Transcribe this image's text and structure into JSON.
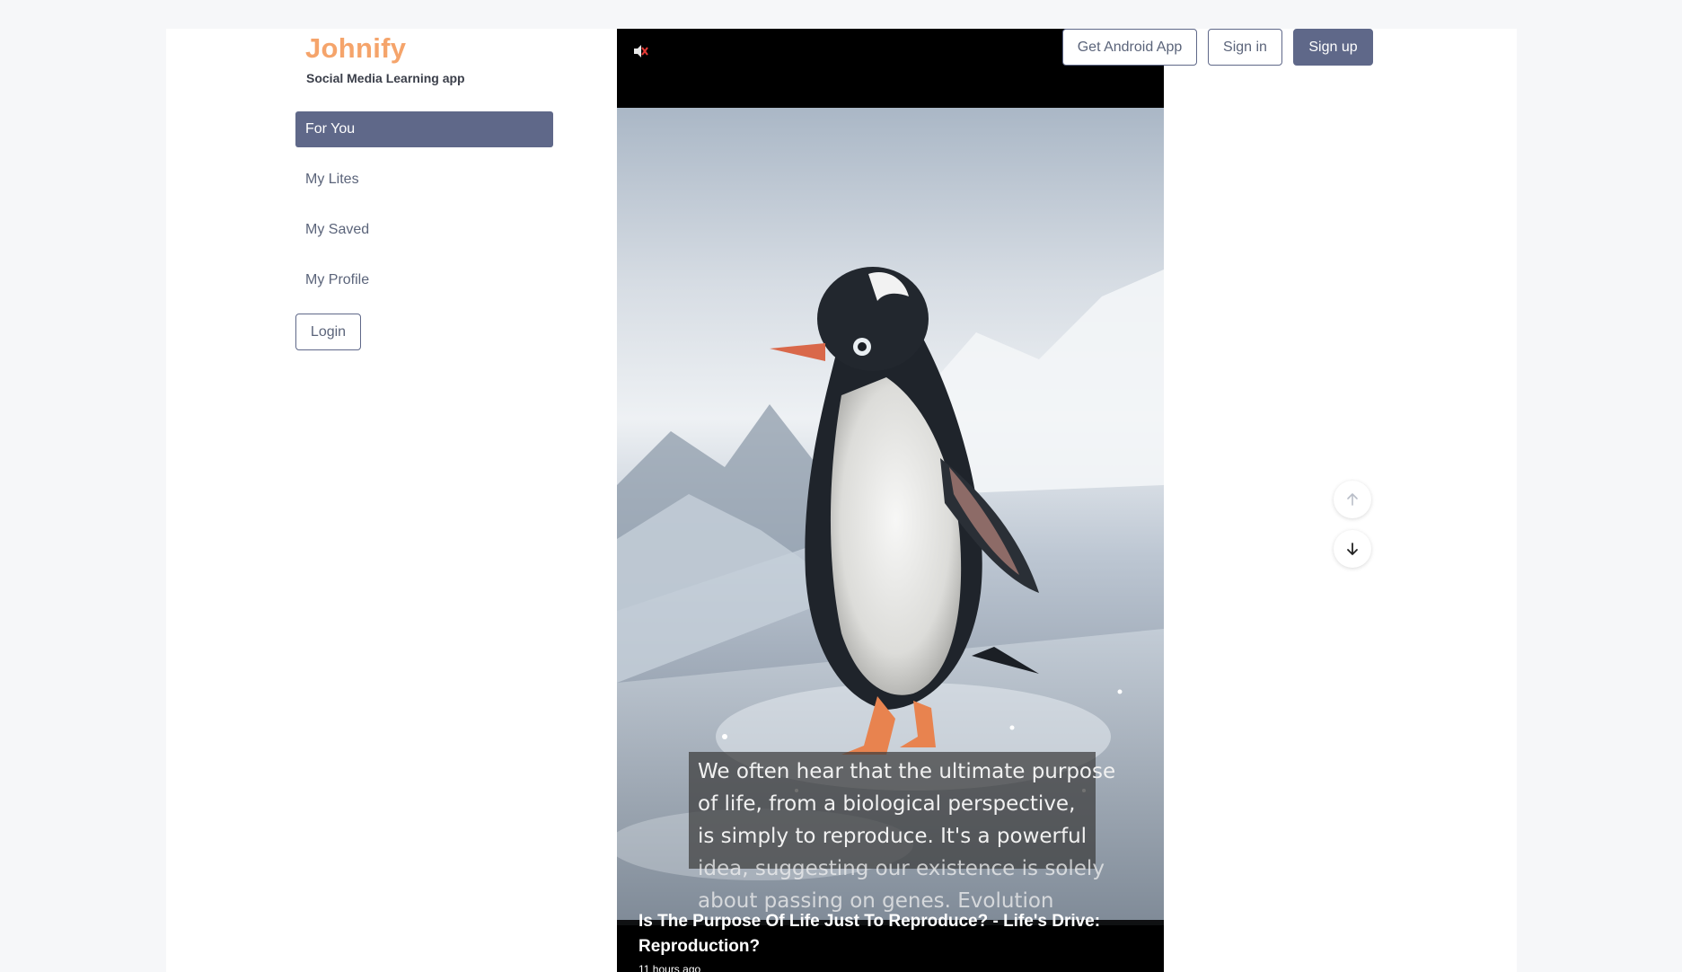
{
  "brand": {
    "name": "Johnify",
    "tagline": "Social Media Learning app"
  },
  "sidebar": {
    "items": [
      {
        "label": "For You",
        "active": true
      },
      {
        "label": "My Lites",
        "active": false
      },
      {
        "label": "My Saved",
        "active": false
      },
      {
        "label": "My Profile",
        "active": false
      }
    ],
    "login_label": "Login"
  },
  "header": {
    "android_label": "Get Android App",
    "signin_label": "Sign in",
    "signup_label": "Sign up"
  },
  "video": {
    "muted": true,
    "caption_lines": [
      "We often hear that the ultimate purpose",
      "of life, from a biological perspective,",
      "is simply to reproduce. It's a powerful",
      "idea, suggesting our existence is solely",
      "about passing on genes. Evolution"
    ],
    "title": "Is The Purpose Of Life Just To Reproduce? - Life's Drive: Reproduction?",
    "posted": "11 hours ago"
  },
  "icons": {
    "mute": "speaker-muted-icon",
    "up": "arrow-up-icon",
    "down": "arrow-down-icon"
  },
  "colors": {
    "brand": "#f5a46b",
    "accent": "#5f6889",
    "nav_text": "#5b647a"
  }
}
